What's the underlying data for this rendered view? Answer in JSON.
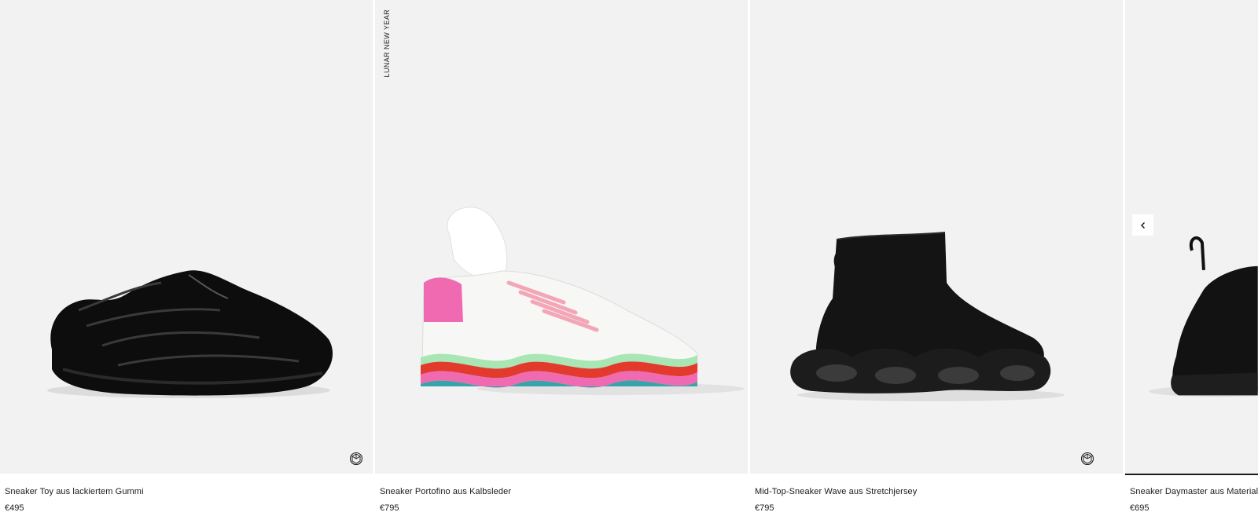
{
  "products": [
    {
      "name": "Sneaker Toy aus lackiertem Gummi",
      "price": "€495",
      "has_360": true
    },
    {
      "name": "Sneaker Portofino aus Kalbsleder",
      "price": "€795",
      "tag": "LUNAR NEW YEAR",
      "has_360": false
    },
    {
      "name": "Mid-Top-Sneaker Wave aus Stretchjersey",
      "price": "€795",
      "has_360": true
    },
    {
      "name": "Sneaker Daymaster aus Materialm",
      "price": "€695",
      "has_360": false
    }
  ],
  "carousel": {
    "prev_icon": "chevron-left-icon"
  },
  "icons": {
    "view_360": "360-view-icon"
  },
  "colors": {
    "card_background": "#f2f2f2",
    "text": "#1a1a1a",
    "pink": "#f06ab2",
    "teal": "#38a3a8",
    "mint": "#a8e6b4",
    "red": "#e23b2e"
  }
}
